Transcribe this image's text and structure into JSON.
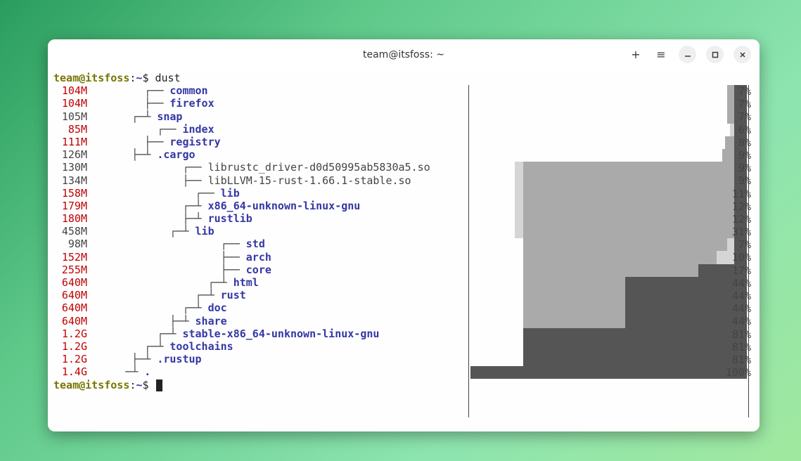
{
  "window": {
    "title": "team@itsfoss: ~"
  },
  "prompt": {
    "user": "team@itsfoss",
    "path": "~",
    "sep": ":",
    "dollar": "$",
    "command": "dust"
  },
  "rows": [
    {
      "size": "104M",
      "size_color": "red",
      "tree": " ┌── ",
      "name": "common",
      "nclass": "blue",
      "indent": 8,
      "pct": "7%",
      "bars": [
        {
          "c": "dark",
          "l": 95.5,
          "r": 100
        },
        {
          "c": "light",
          "l": 93,
          "r": 95.5
        }
      ]
    },
    {
      "size": "104M",
      "size_color": "red",
      "tree": " ├── ",
      "name": "firefox",
      "nclass": "blue",
      "indent": 8,
      "pct": "7%",
      "bars": [
        {
          "c": "dark",
          "l": 95.5,
          "r": 100
        },
        {
          "c": "light",
          "l": 93,
          "r": 95.5
        }
      ]
    },
    {
      "size": "105M",
      "size_color": "grey",
      "tree": " ┌─┴ ",
      "name": "snap",
      "nclass": "blue",
      "indent": 6,
      "pct": "7%",
      "bars": [
        {
          "c": "dark",
          "l": 95.5,
          "r": 100
        },
        {
          "c": "light",
          "l": 93,
          "r": 95.5
        }
      ]
    },
    {
      "size": "85M",
      "size_color": "red",
      "tree": " ┌── ",
      "name": "index",
      "nclass": "blue",
      "indent": 10,
      "pct": "6%",
      "bars": [
        {
          "c": "dark",
          "l": 95.5,
          "r": 100
        },
        {
          "c": "vlight",
          "l": 94,
          "r": 95.5
        }
      ]
    },
    {
      "size": "111M",
      "size_color": "red",
      "tree": " ├── ",
      "name": "registry",
      "nclass": "blue",
      "indent": 8,
      "pct": "8%",
      "bars": [
        {
          "c": "dark",
          "l": 95.5,
          "r": 100
        },
        {
          "c": "light",
          "l": 92,
          "r": 95.5
        }
      ]
    },
    {
      "size": "126M",
      "size_color": "grey",
      "tree": " ├─┴ ",
      "name": ".cargo",
      "nclass": "blue",
      "indent": 6,
      "pct": "9%",
      "bars": [
        {
          "c": "dark",
          "l": 95.5,
          "r": 100
        },
        {
          "c": "light",
          "l": 91,
          "r": 95.5
        }
      ]
    },
    {
      "size": "130M",
      "size_color": "grey",
      "tree": " ┌── ",
      "name": "librustc_driver-d0d50995ab5830a5.so",
      "nclass": "plain",
      "indent": 14,
      "pct": "9%",
      "bars": [
        {
          "c": "dark",
          "l": 95.5,
          "r": 100
        },
        {
          "c": "light",
          "l": 19,
          "r": 95.5
        },
        {
          "c": "vlight",
          "l": 16,
          "r": 19
        }
      ]
    },
    {
      "size": "134M",
      "size_color": "grey",
      "tree": " ├── ",
      "name": "libLLVM-15-rust-1.66.1-stable.so",
      "nclass": "plain",
      "indent": 14,
      "pct": "9%",
      "bars": [
        {
          "c": "dark",
          "l": 95.5,
          "r": 100
        },
        {
          "c": "light",
          "l": 19,
          "r": 95.5
        },
        {
          "c": "vlight",
          "l": 16,
          "r": 19
        }
      ]
    },
    {
      "size": "158M",
      "size_color": "red",
      "tree": " ┌── ",
      "name": "lib",
      "nclass": "blue",
      "indent": 16,
      "pct": "11%",
      "bars": [
        {
          "c": "dark",
          "l": 95.5,
          "r": 100
        },
        {
          "c": "light",
          "l": 19,
          "r": 95.5
        },
        {
          "c": "vlight",
          "l": 16,
          "r": 19
        }
      ]
    },
    {
      "size": "179M",
      "size_color": "red",
      "tree": " ┌─┴ ",
      "name": "x86_64-unknown-linux-gnu",
      "nclass": "blue",
      "indent": 14,
      "pct": "12%",
      "bars": [
        {
          "c": "dark",
          "l": 95.5,
          "r": 100
        },
        {
          "c": "light",
          "l": 19,
          "r": 95.5
        },
        {
          "c": "vlight",
          "l": 16,
          "r": 19
        }
      ]
    },
    {
      "size": "180M",
      "size_color": "red",
      "tree": " ├─┴ ",
      "name": "rustlib",
      "nclass": "blue",
      "indent": 14,
      "pct": "12%",
      "bars": [
        {
          "c": "dark",
          "l": 95.5,
          "r": 100
        },
        {
          "c": "light",
          "l": 19,
          "r": 95.5
        },
        {
          "c": "vlight",
          "l": 16,
          "r": 19
        }
      ]
    },
    {
      "size": "458M",
      "size_color": "grey",
      "tree": " ┌─┴ ",
      "name": "lib",
      "nclass": "blue",
      "indent": 12,
      "pct": "31%",
      "bars": [
        {
          "c": "dark",
          "l": 95.5,
          "r": 100
        },
        {
          "c": "light",
          "l": 19,
          "r": 95.5
        },
        {
          "c": "vlight",
          "l": 16,
          "r": 19
        }
      ]
    },
    {
      "size": "98M",
      "size_color": "grey",
      "tree": " ┌── ",
      "name": "std",
      "nclass": "blue",
      "indent": 20,
      "pct": "7%",
      "bars": [
        {
          "c": "dark",
          "l": 95.5,
          "r": 100
        },
        {
          "c": "light",
          "l": 19,
          "r": 95.5
        },
        {
          "c": "vlight",
          "l": 93,
          "r": 95.5
        }
      ]
    },
    {
      "size": "152M",
      "size_color": "red",
      "tree": " ├── ",
      "name": "arch",
      "nclass": "blue",
      "indent": 20,
      "pct": "10%",
      "bars": [
        {
          "c": "dark",
          "l": 95.5,
          "r": 100
        },
        {
          "c": "light",
          "l": 19,
          "r": 95.5
        },
        {
          "c": "vlight",
          "l": 89,
          "r": 95.5
        }
      ]
    },
    {
      "size": "255M",
      "size_color": "red",
      "tree": " ├── ",
      "name": "core",
      "nclass": "blue",
      "indent": 20,
      "pct": "17%",
      "bars": [
        {
          "c": "dark",
          "l": 82.5,
          "r": 100
        },
        {
          "c": "light",
          "l": 19,
          "r": 82.5
        }
      ]
    },
    {
      "size": "640M",
      "size_color": "red",
      "tree": " ┌─┴ ",
      "name": "html",
      "nclass": "blue",
      "indent": 18,
      "pct": "44%",
      "bars": [
        {
          "c": "dark",
          "l": 56,
          "r": 100
        },
        {
          "c": "light",
          "l": 19,
          "r": 56
        }
      ]
    },
    {
      "size": "640M",
      "size_color": "red",
      "tree": " ┌─┴ ",
      "name": "rust",
      "nclass": "blue",
      "indent": 16,
      "pct": "44%",
      "bars": [
        {
          "c": "dark",
          "l": 56,
          "r": 100
        },
        {
          "c": "light",
          "l": 19,
          "r": 56
        }
      ]
    },
    {
      "size": "640M",
      "size_color": "red",
      "tree": " ┌─┴ ",
      "name": "doc",
      "nclass": "blue",
      "indent": 14,
      "pct": "44%",
      "bars": [
        {
          "c": "dark",
          "l": 56,
          "r": 100
        },
        {
          "c": "light",
          "l": 19,
          "r": 56
        }
      ]
    },
    {
      "size": "640M",
      "size_color": "red",
      "tree": " ├─┴ ",
      "name": "share",
      "nclass": "blue",
      "indent": 12,
      "pct": "44%",
      "bars": [
        {
          "c": "dark",
          "l": 56,
          "r": 100
        },
        {
          "c": "light",
          "l": 19,
          "r": 56
        }
      ]
    },
    {
      "size": "1.2G",
      "size_color": "red",
      "tree": " ┌─┴ ",
      "name": "stable-x86_64-unknown-linux-gnu",
      "nclass": "blue",
      "indent": 10,
      "pct": "81%",
      "bars": [
        {
          "c": "dark",
          "l": 19,
          "r": 100
        }
      ]
    },
    {
      "size": "1.2G",
      "size_color": "red",
      "tree": " ┌─┴ ",
      "name": "toolchains",
      "nclass": "blue",
      "indent": 8,
      "pct": "81%",
      "bars": [
        {
          "c": "dark",
          "l": 19,
          "r": 100
        }
      ]
    },
    {
      "size": "1.2G",
      "size_color": "red",
      "tree": " ├─┴ ",
      "name": ".rustup",
      "nclass": "blue",
      "indent": 6,
      "pct": "81%",
      "bars": [
        {
          "c": "dark",
          "l": 19,
          "r": 100
        }
      ]
    },
    {
      "size": "1.4G",
      "size_color": "red",
      "tree": "─┴ ",
      "name": ".",
      "nclass": "blue",
      "indent": 6,
      "pct": "100%",
      "bars": [
        {
          "c": "dark",
          "l": 0,
          "r": 100
        }
      ]
    }
  ]
}
